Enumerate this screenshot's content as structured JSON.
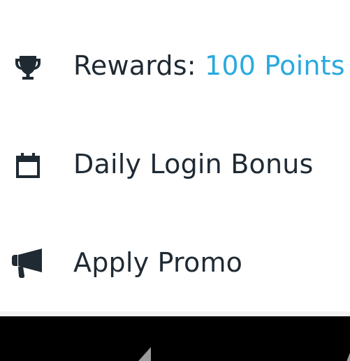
{
  "menu": {
    "rewards": {
      "label_prefix": "Rewards:",
      "points": "100 Points",
      "icon": "trophy-icon"
    },
    "daily_login": {
      "label": "Daily Login Bonus",
      "icon": "calendar-icon"
    },
    "apply_promo": {
      "label": "Apply Promo",
      "icon": "megaphone-icon"
    }
  },
  "colors": {
    "text": "#1f2a33",
    "accent": "#2aa9e0",
    "icon": "#1f2a33",
    "nav_bar": "#000000",
    "nav_icon": "#9a9a9a"
  },
  "navigation": {
    "back_icon": "back-triangle-icon"
  }
}
